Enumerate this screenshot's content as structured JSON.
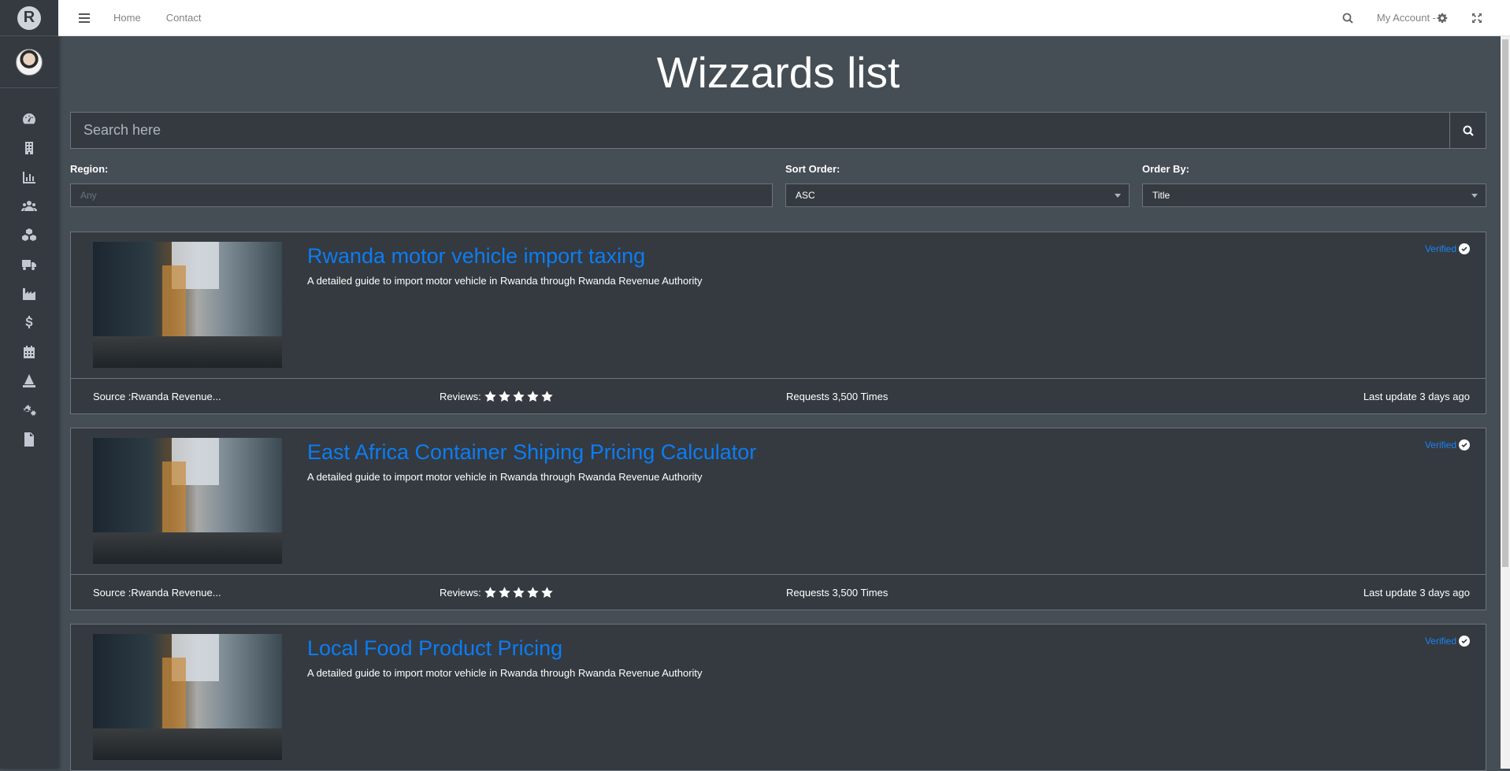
{
  "brand": {
    "logo_text": "R"
  },
  "sidebar": {
    "items": [
      {
        "icon": "dashboard-icon"
      },
      {
        "icon": "building-icon"
      },
      {
        "icon": "chart-icon"
      },
      {
        "icon": "users-icon"
      },
      {
        "icon": "cubes-icon"
      },
      {
        "icon": "truck-icon"
      },
      {
        "icon": "industry-icon"
      },
      {
        "icon": "dollar-icon"
      },
      {
        "icon": "calendar-icon"
      },
      {
        "icon": "wizard-icon"
      },
      {
        "icon": "cogs-icon"
      },
      {
        "icon": "file-icon"
      }
    ]
  },
  "topbar": {
    "home": "Home",
    "contact": "Contact",
    "account": "My Account -"
  },
  "page": {
    "title": "Wizzards list",
    "search_placeholder": "Search here"
  },
  "filters": {
    "region_label": "Region:",
    "region_value": "Any",
    "sort_label": "Sort Order:",
    "sort_value": "ASC",
    "order_label": "Order By:",
    "order_value": "Title"
  },
  "cards": [
    {
      "title": "Rwanda motor vehicle import taxing",
      "description": "A detailed guide to import motor vehicle in Rwanda through Rwanda Revenue Authority",
      "verified": "Verified",
      "source": "Source :Rwanda Revenue...",
      "reviews_label": "Reviews:",
      "rating": 5,
      "requests": "Requests 3,500 Times",
      "updated": "Last update 3 days ago"
    },
    {
      "title": "East Africa Container Shiping Pricing Calculator",
      "description": "A detailed guide to import motor vehicle in Rwanda through Rwanda Revenue Authority",
      "verified": "Verified",
      "source": "Source :Rwanda Revenue...",
      "reviews_label": "Reviews:",
      "rating": 5,
      "requests": "Requests 3,500 Times",
      "updated": "Last update 3 days ago"
    },
    {
      "title": "Local Food Product Pricing",
      "description": "A detailed guide to import motor vehicle in Rwanda through Rwanda Revenue Authority",
      "verified": "Verified"
    }
  ],
  "colors": {
    "sidebar_bg": "#343a40",
    "content_bg": "#454d55",
    "link_blue": "#0d7cf2",
    "verified_blue": "#1b84f5"
  }
}
